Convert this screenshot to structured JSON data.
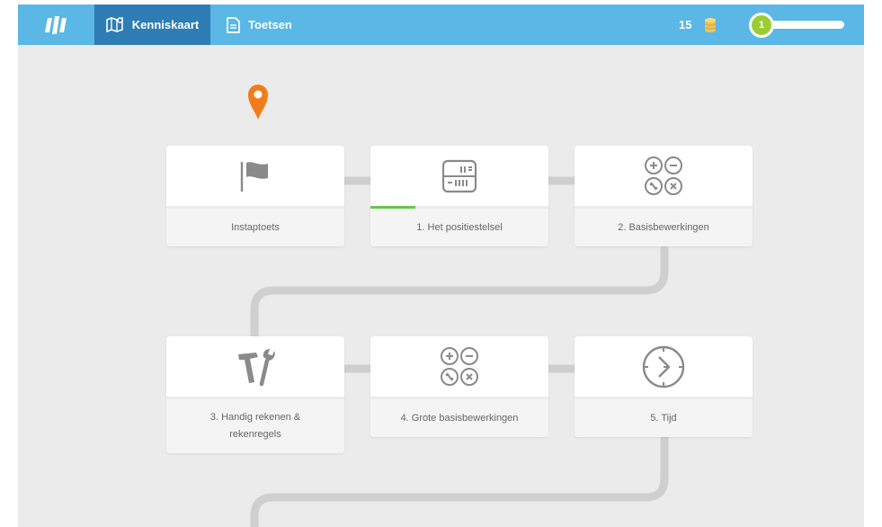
{
  "topbar": {
    "logo_icon": "app-logo-icon",
    "tabs": [
      {
        "label": "Kenniskaart",
        "icon": "map-icon",
        "active": true
      },
      {
        "label": "Toetsen",
        "icon": "document-icon",
        "active": false
      }
    ],
    "coins": {
      "count": "15",
      "icon": "coins-icon"
    },
    "level": {
      "number": "1",
      "progress": 0.05
    }
  },
  "map": {
    "location_icon": "location-pin-icon",
    "nodes": [
      {
        "label": "Instaptoets",
        "icon": "flag-icon",
        "progress": 0
      },
      {
        "label": "1. Het positiestelsel",
        "icon": "abacus-icon",
        "progress": 0.25
      },
      {
        "label": "2. Basisbewerkingen",
        "icon": "operations-icon",
        "progress": 0
      },
      {
        "label": "3. Handig rekenen & rekenregels",
        "icon": "tools-icon",
        "progress": 0
      },
      {
        "label": "4. Grote basisbewerkingen",
        "icon": "operations-icon",
        "progress": 0
      },
      {
        "label": "5. Tijd",
        "icon": "clock-icon",
        "progress": 0
      }
    ]
  },
  "colors": {
    "topbar": "#5ab7e6",
    "active_tab": "#2f7db5",
    "background": "#ebebeb",
    "path": "#cfcfcf",
    "pin": "#f07d1a",
    "progress": "#6cc24a",
    "level_badge": "#9acd32",
    "icon": "#8a8a8a"
  }
}
